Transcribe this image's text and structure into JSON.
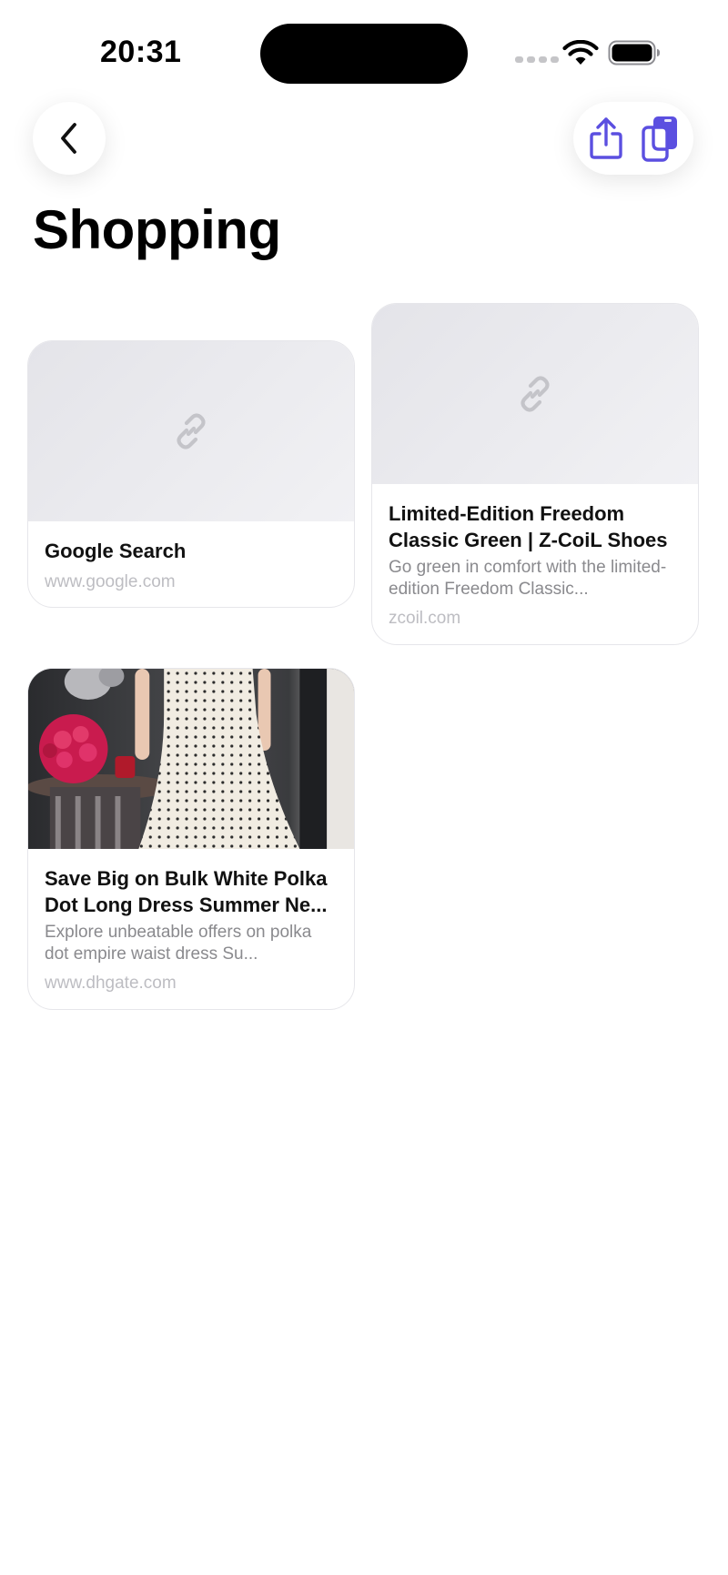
{
  "status_bar": {
    "time": "20:31"
  },
  "page": {
    "title": "Shopping"
  },
  "icons": {
    "back": "chevron-left-icon",
    "share": "share-icon",
    "copy": "copy-icon",
    "link": "link-icon"
  },
  "colors": {
    "accent": "#5B4FE0",
    "placeholder_bg": "#E8E8EC",
    "secondary_text": "#8A8A8E",
    "domain_text": "#BDBDC2"
  },
  "cards": [
    {
      "title": "Google Search",
      "description": "",
      "domain": "www.google.com"
    },
    {
      "title": "Limited-Edition Freedom Classic Green | Z-CoiL Shoes",
      "description": "Go green in comfort with the limited-edition Freedom Classic...",
      "domain": "zcoil.com"
    },
    {
      "title": "Save Big on Bulk White Polka Dot Long Dress Summer Ne...",
      "description": "Explore unbeatable offers on polka dot empire waist dress Su...",
      "domain": "www.dhgate.com"
    }
  ]
}
